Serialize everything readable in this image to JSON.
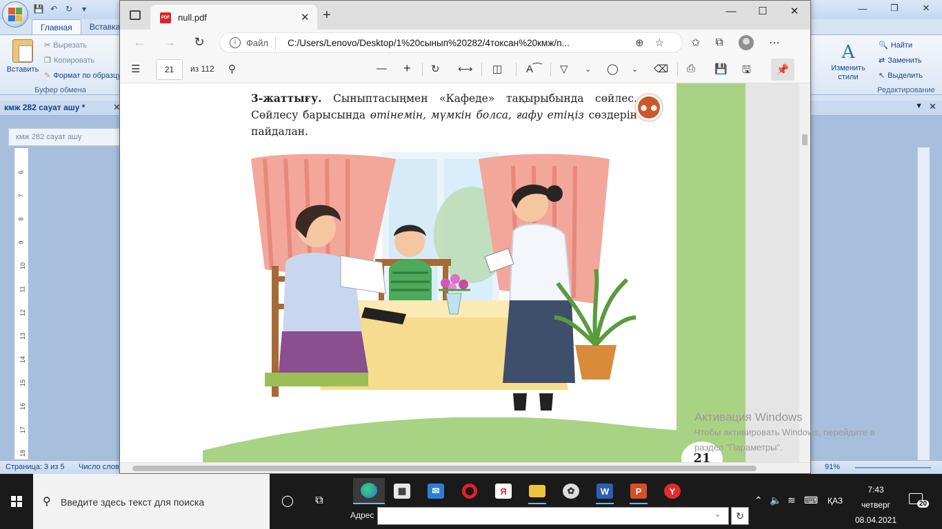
{
  "word": {
    "tabs": [
      "Главная",
      "Вставка"
    ],
    "clipboard": {
      "paste_label": "Вставить",
      "cut_label": "Вырезать",
      "copy_label": "Копировать",
      "format_label": "Формат по образцу",
      "group_label": "Буфер обмена"
    },
    "find_label": "Найти",
    "replace_label": "Заменить",
    "select_label": "Выделить",
    "styles_label": "Изменить стили",
    "editing_group_label": "Редактирование",
    "document_tab": "кмж 282 сауат ашу *",
    "doc_title_strip": "кмж 282 сауат ашу",
    "ruler_numbers": [
      "6",
      "7",
      "8",
      "9",
      "10",
      "11",
      "12",
      "13",
      "14",
      "15",
      "16",
      "17",
      "18"
    ],
    "status_page": "Страница: 3 из 5",
    "status_words": "Число слов",
    "zoom": "91%"
  },
  "edge": {
    "tab_title": "null.pdf",
    "file_label": "Файл",
    "url": "C:/Users/Lenovo/Desktop/1%20сынып%20282/4токсан%20кмж/n...",
    "pdf": {
      "current_page": "21",
      "page_total": "из 112"
    }
  },
  "pdf_page": {
    "exercise_label": "3-жаттығу.",
    "text_part1": " Сыныптасыңмен «Кафеде» тақырыбында сөйлес. Сөйлесу барысында ",
    "italic_words": "өтінемін, мүмкін болса, ғафу етіңіз",
    "text_part2": " сөздерін пайдалан.",
    "page_number": "21"
  },
  "activation": {
    "title": "Активация Windows",
    "line1": "Чтобы активировать Windows, перейдите в",
    "line2": "раздел \"Параметры\"."
  },
  "taskbar": {
    "search_placeholder": "Введите здесь текст для поиска",
    "address_label": "Адрес",
    "language": "ҚАЗ",
    "time": "7:43",
    "day": "четверг",
    "date": "08.04.2021",
    "notification_count": "20"
  },
  "colors": {
    "page_green": "#a9d384",
    "pdf_red": "#d7262e",
    "taskbar": "#1a1a1a"
  }
}
